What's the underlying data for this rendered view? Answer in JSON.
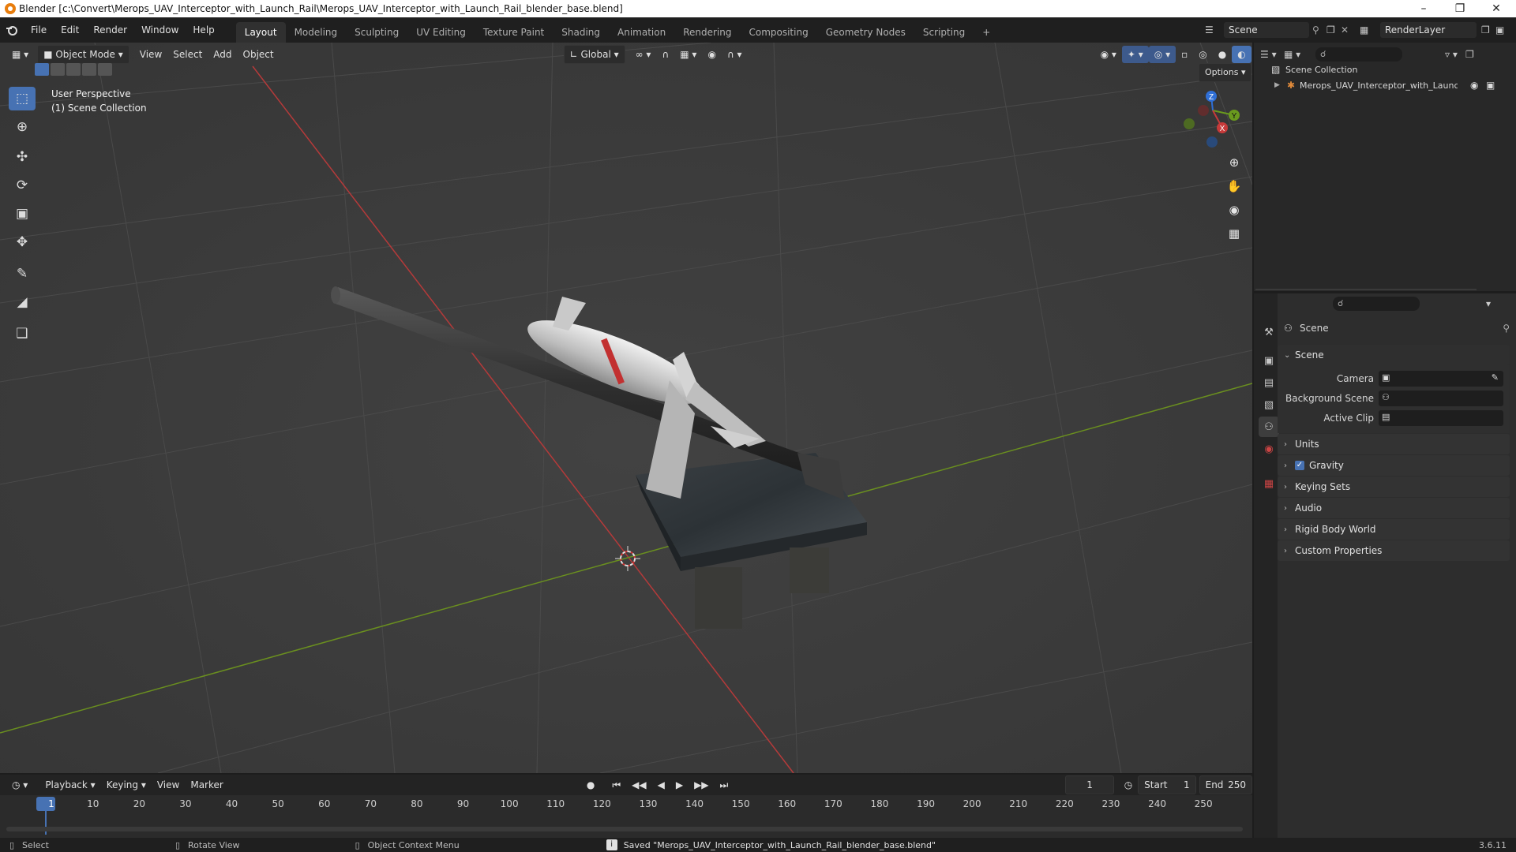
{
  "window": {
    "title": "Blender [c:\\Convert\\Merops_UAV_Interceptor_with_Launch_Rail\\Merops_UAV_Interceptor_with_Launch_Rail_blender_base.blend]"
  },
  "menus": [
    "File",
    "Edit",
    "Render",
    "Window",
    "Help"
  ],
  "workspaces": [
    "Layout",
    "Modeling",
    "Sculpting",
    "UV Editing",
    "Texture Paint",
    "Shading",
    "Animation",
    "Rendering",
    "Compositing",
    "Geometry Nodes",
    "Scripting"
  ],
  "workspace_add": "+",
  "scene_selector": {
    "value": "Scene"
  },
  "render_layer": {
    "value": "RenderLayer"
  },
  "viewport": {
    "mode": "Object Mode",
    "header_menus": [
      "View",
      "Select",
      "Add",
      "Object"
    ],
    "transform_orientation": "Global",
    "options_label": "Options",
    "overlay_line1": "User Perspective",
    "overlay_line2": "(1) Scene Collection",
    "gizmo_axes": {
      "x": "X",
      "y": "Y",
      "z": "Z"
    }
  },
  "toolbar_icons": [
    "select-box-icon",
    "cursor-icon",
    "move-icon",
    "rotate-icon",
    "scale-icon",
    "transform-icon",
    "annotate-icon",
    "measure-icon",
    "add-cube-icon"
  ],
  "outliner": {
    "root": "Scene Collection",
    "items": [
      {
        "label": "Merops_UAV_Interceptor_with_Launch_"
      }
    ]
  },
  "properties": {
    "header": "Scene",
    "panel_title": "Scene",
    "fields": [
      {
        "label": "Camera"
      },
      {
        "label": "Background Scene"
      },
      {
        "label": "Active Clip"
      }
    ],
    "panels": [
      {
        "label": "Units"
      },
      {
        "label": "Gravity",
        "checked": true
      },
      {
        "label": "Keying Sets"
      },
      {
        "label": "Audio"
      },
      {
        "label": "Rigid Body World"
      },
      {
        "label": "Custom Properties"
      }
    ]
  },
  "timeline": {
    "menus": [
      "Playback",
      "Keying",
      "View",
      "Marker"
    ],
    "current_frame": "1",
    "start_label": "Start",
    "start": "1",
    "end_label": "End",
    "end": "250",
    "ticks": [
      "1",
      "10",
      "20",
      "30",
      "40",
      "50",
      "60",
      "70",
      "80",
      "90",
      "100",
      "110",
      "120",
      "130",
      "140",
      "150",
      "160",
      "170",
      "180",
      "190",
      "200",
      "210",
      "220",
      "230",
      "240",
      "250"
    ]
  },
  "statusbar": {
    "select": "Select",
    "rotate": "Rotate View",
    "context": "Object Context Menu",
    "message": "Saved \"Merops_UAV_Interceptor_with_Launch_Rail_blender_base.blend\"",
    "version": "3.6.11"
  },
  "colors": {
    "accent": "#4772b3",
    "x_axis": "#c73a3a",
    "y_axis": "#6a9a1e",
    "z_axis": "#2f6fd6"
  }
}
